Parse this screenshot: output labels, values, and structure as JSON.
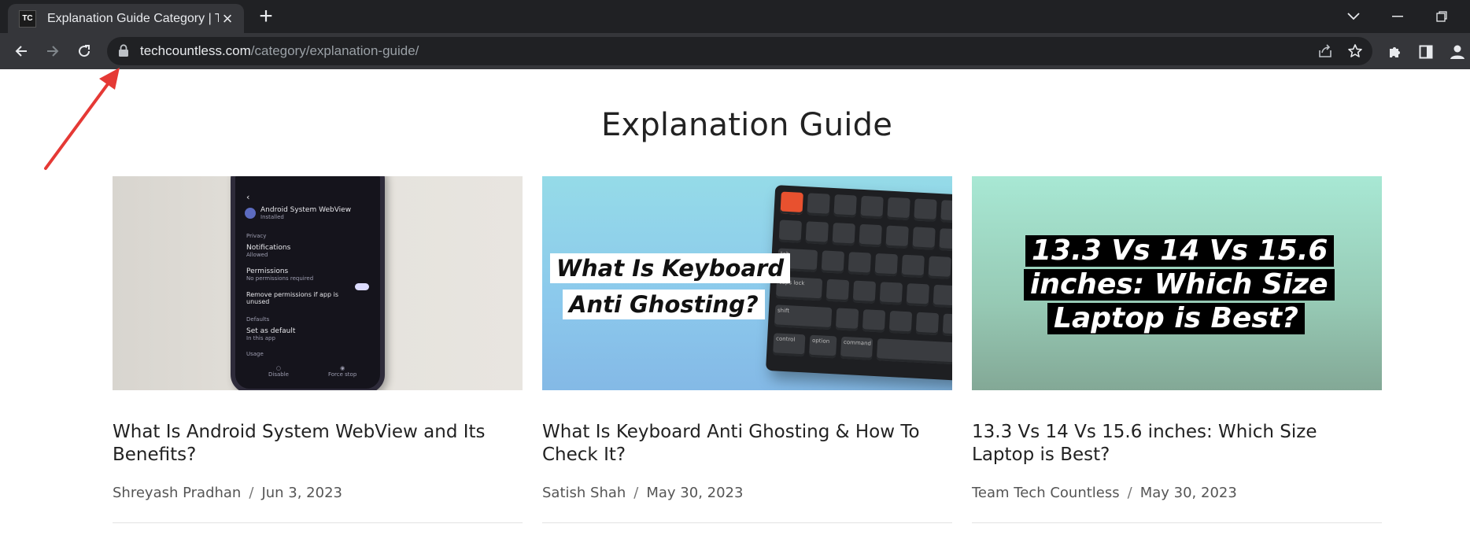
{
  "browser": {
    "tab_title": "Explanation Guide Category | Tec",
    "favicon_text": "TC",
    "url_host": "techcountless.com",
    "url_path": "/category/explanation-guide/"
  },
  "page": {
    "title": "Explanation Guide"
  },
  "posts": [
    {
      "title": "What Is Android System WebView and Its Benefits?",
      "author": "Shreyash Pradhan",
      "date": "Jun 3, 2023",
      "thumb": {
        "app_name": "Android System WebView",
        "app_status": "Installed",
        "privacy": "Privacy",
        "notifications": "Notifications",
        "notifications_sub": "Allowed",
        "permissions": "Permissions",
        "permissions_sub": "No permissions required",
        "remove_permissions": "Remove permissions if app is unused",
        "defaults": "Defaults",
        "set_default": "Set as default",
        "set_default_sub": "In this app",
        "usage": "Usage",
        "disable": "Disable",
        "force_stop": "Force stop"
      }
    },
    {
      "title": "What Is Keyboard Anti Ghosting & How To Check It?",
      "author": "Satish Shah",
      "date": "May 30, 2023",
      "thumb": {
        "line1": "What Is Keyboard",
        "line2": "Anti Ghosting?",
        "keys": [
          "tab",
          "caps lock",
          "shift",
          "control",
          "option",
          "command"
        ]
      }
    },
    {
      "title": "13.3 Vs 14 Vs 15.6 inches: Which Size Laptop is Best?",
      "author": "Team Tech Countless",
      "date": "May 30, 2023",
      "thumb": {
        "line1": "13.3 Vs 14 Vs 15.6",
        "line2": "inches: Which Size",
        "line3": "Laptop is Best?"
      }
    }
  ],
  "meta_separator": "/",
  "annotation": {
    "arrow_color": "#e53935",
    "points_to": "lock-icon"
  },
  "colors": {
    "chrome_dark": "#202124",
    "chrome_toolbar": "#35363a",
    "text": "#222222"
  }
}
